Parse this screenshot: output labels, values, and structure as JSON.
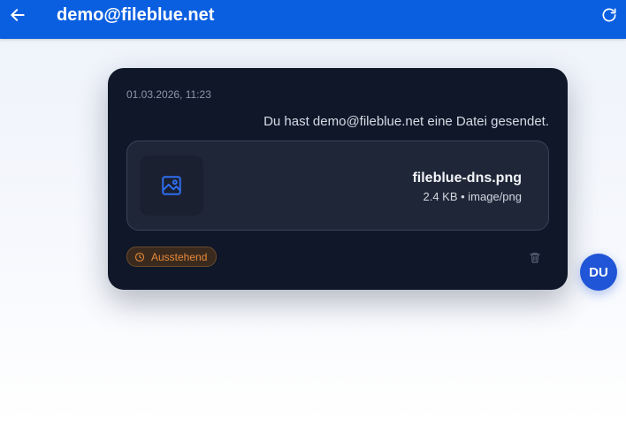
{
  "header": {
    "title": "demo@fileblue.net",
    "back_icon": "arrow-left-icon",
    "refresh_icon": "refresh-icon"
  },
  "message_card": {
    "timestamp": "01.03.2026, 11:23",
    "text": "Du hast demo@fileblue.net eine Datei gesendet.",
    "attachment": {
      "icon": "image-icon",
      "file_name": "fileblue-dns.png",
      "file_meta": "2.4 KB • image/png"
    },
    "status": {
      "label": "Ausstehend",
      "icon": "clock-icon",
      "color": "#e6893a"
    },
    "delete_icon": "trash-icon"
  },
  "avatar": {
    "initials": "DU"
  },
  "colors": {
    "header_bg": "#0a5fe0",
    "card_bg": "#0f1729",
    "avatar_bg": "#1f55d6",
    "accent_icon": "#2f6ef0"
  }
}
